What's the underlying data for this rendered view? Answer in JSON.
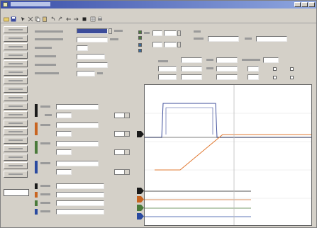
{
  "window": {
    "title": ""
  },
  "menu": [
    "",
    "",
    ""
  ],
  "sidebar": {
    "item_count": 18,
    "selected_label": ""
  },
  "form_left": {
    "rows": [
      {
        "label": "",
        "value": ""
      },
      {
        "label": "",
        "value": ""
      },
      {
        "label": "",
        "value": ""
      },
      {
        "label": "",
        "value": ""
      },
      {
        "label": "",
        "value": ""
      },
      {
        "label": "",
        "value": ""
      }
    ]
  },
  "top_right": {
    "mode_label": "",
    "name_label": "",
    "size_label": ""
  },
  "channels": [
    {
      "color": "#1a1a1a",
      "label": "",
      "value": ""
    },
    {
      "color": "#c86420",
      "label": "",
      "value": ""
    },
    {
      "color": "#4a7a3a",
      "label": "",
      "value": ""
    },
    {
      "color": "#2a4aa0",
      "label": "",
      "value": ""
    }
  ],
  "digital_channels": [
    {
      "color": "#1a1a1a",
      "label": ""
    },
    {
      "color": "#c86420",
      "label": ""
    },
    {
      "color": "#4a7a3a",
      "label": ""
    },
    {
      "color": "#2a4aa0",
      "label": ""
    }
  ],
  "waveform": {
    "pulse_color": "#3c4c9a",
    "ramp_color": "#e07830"
  }
}
